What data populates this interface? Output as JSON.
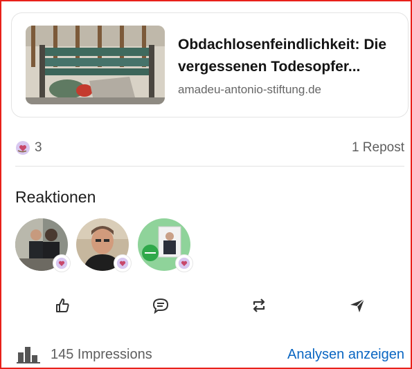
{
  "link_preview": {
    "title": "Obdachlosenfeindlichkeit: Die vergessenen Todesopfer...",
    "domain": "amadeu-antonio-stiftung.de"
  },
  "stats": {
    "reactions_count": "3",
    "reposts": "1 Repost"
  },
  "reactions": {
    "heading": "Reaktionen",
    "avatars": [
      {
        "name": "reactor-1",
        "reaction": "heart-hand-icon"
      },
      {
        "name": "reactor-2",
        "reaction": "heart-hand-icon"
      },
      {
        "name": "reactor-3",
        "reaction": "heart-hand-icon"
      }
    ]
  },
  "actions": [
    {
      "icon": "like-thumb-icon"
    },
    {
      "icon": "comment-icon"
    },
    {
      "icon": "repost-icon"
    },
    {
      "icon": "send-icon"
    }
  ],
  "footer": {
    "impressions": "145 Impressions",
    "analytics_link": "Analysen anzeigen"
  },
  "colors": {
    "frame": "#e8201a",
    "link": "#0a66c2",
    "reaction_bg": "#d8c8f0",
    "reaction_heart": "#c7486b"
  }
}
